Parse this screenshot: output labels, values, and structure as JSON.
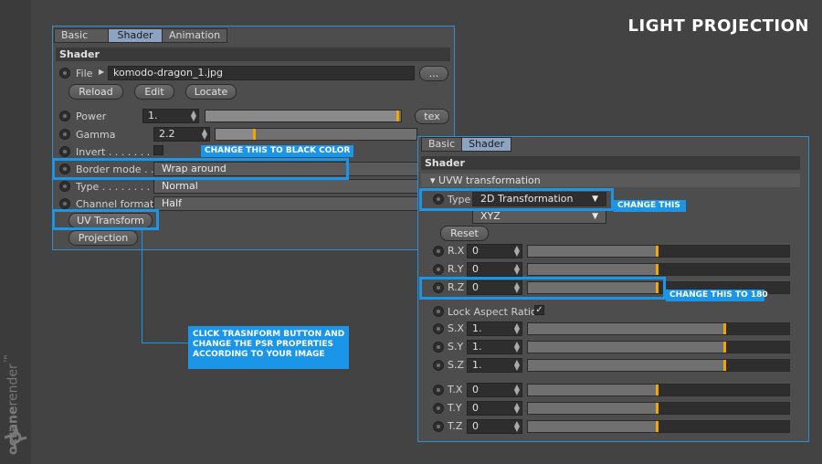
{
  "headline": "LIGHT PROJECTION",
  "brand": {
    "bold": "octane",
    "rest": "render",
    "mark": "™"
  },
  "left_panel": {
    "tabs": [
      "Basic",
      "Shader",
      "Animation"
    ],
    "section": "Shader",
    "file": {
      "label": "File",
      "value": "komodo-dragon_1.jpg",
      "browse": "..."
    },
    "file_buttons": [
      "Reload",
      "Edit",
      "Locate"
    ],
    "power": {
      "label": "Power",
      "value": "1.",
      "tex": "tex",
      "level": 0.99
    },
    "gamma": {
      "label": "Gamma",
      "value": "2.2",
      "level": 0.2
    },
    "invert": {
      "label": "Invert . . . . . . . ."
    },
    "border_mode": {
      "label": "Border mode . .",
      "value": "Wrap around"
    },
    "type": {
      "label": "Type . . . . . . . . .",
      "value": "Normal"
    },
    "channel_format": {
      "label": "Channel format",
      "value": "Half"
    },
    "uv_transform": "UV Transform",
    "projection": "Projection"
  },
  "right_panel": {
    "tabs": [
      "Basic",
      "Shader"
    ],
    "section": "Shader",
    "subsection": "UVW transformation",
    "type": {
      "label": "Type",
      "value": "2D Transformation"
    },
    "xyz": "XYZ",
    "reset": "Reset",
    "rotation": [
      {
        "label": "R.X",
        "value": "0",
        "level": 0.5
      },
      {
        "label": "R.Y",
        "value": "0",
        "level": 0.5
      },
      {
        "label": "R.Z",
        "value": "0",
        "level": 0.5
      }
    ],
    "lock_aspect": "Lock Aspect Ratio",
    "lock_check": "✓",
    "scale": [
      {
        "label": "S.X",
        "value": "1.",
        "level": 0.76
      },
      {
        "label": "S.Y",
        "value": "1.",
        "level": 0.76
      },
      {
        "label": "S.Z",
        "value": "1.",
        "level": 0.76
      }
    ],
    "translation": [
      {
        "label": "T.X",
        "value": "0",
        "level": 0.5
      },
      {
        "label": "T.Y",
        "value": "0",
        "level": 0.5
      },
      {
        "label": "T.Z",
        "value": "0",
        "level": 0.5
      }
    ]
  },
  "callouts": {
    "border": "CHANGE THIS TO BLACK COLOR",
    "type": "CHANGE THIS",
    "rz": "CHANGE THIS TO 180",
    "uv_line1": "CLICK TRASNFORM BUTTON AND",
    "uv_line2": "CHANGE THE PSR PROPERTIES",
    "uv_line3": "ACCORDING TO YOUR IMAGE"
  },
  "colors": {
    "accent": "#1b95e8",
    "slider_mark": "#f1a600",
    "tab_active": "#8da3c2"
  }
}
